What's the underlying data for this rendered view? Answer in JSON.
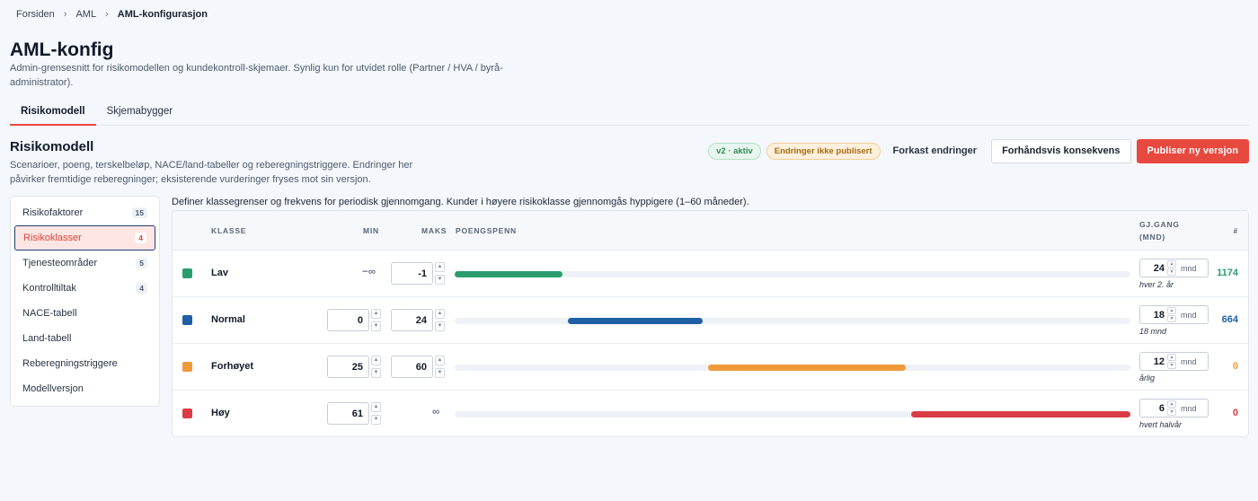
{
  "breadcrumb": {
    "home": "Forsiden",
    "section": "AML",
    "current": "AML-konfigurasjon",
    "separator": "›"
  },
  "page": {
    "title": "AML-konfig",
    "subtitle": "Admin-grensesnitt for risikomodellen og kundekontroll-skjemaer. Synlig kun for utvidet rolle (Partner / HVA / byrå-administrator)."
  },
  "tabs": [
    {
      "label": "Risikomodell"
    },
    {
      "label": "Skjemabygger"
    }
  ],
  "section": {
    "title": "Risikomodell",
    "description": "Scenarioer, poeng, terskelbeløp, NACE/land-tabeller og reberegningstriggere. Endringer her påvirker fremtidige reberegninger; eksisterende vurderinger fryses mot sin versjon."
  },
  "actions": {
    "version_badge": "v2 · aktiv",
    "unpublished_badge": "Endringer ikke publisert",
    "discard": "Forkast endringer",
    "preview": "Forhåndsvis konsekvens",
    "publish": "Publiser ny versjon"
  },
  "sidebar": {
    "items": [
      {
        "label": "Risikofaktorer",
        "count": "15"
      },
      {
        "label": "Risikoklasser",
        "count": "4"
      },
      {
        "label": "Tjenesteområder",
        "count": "5"
      },
      {
        "label": "Kontrolltiltak",
        "count": "4"
      },
      {
        "label": "NACE-tabell"
      },
      {
        "label": "Land-tabell"
      },
      {
        "label": "Reberegningstriggere"
      },
      {
        "label": "Modellversjon"
      }
    ]
  },
  "content": {
    "description": "Definer klassegrenser og frekvens for periodisk gjennomgang. Kunder i høyere risikoklasse gjennomgås hyppigere (1–60 måneder).",
    "headers": {
      "klasse": "KLASSE",
      "min": "MIN",
      "maks": "MAKS",
      "poengspenn": "POENGSPENN",
      "gjgang_1": "GJ.GANG",
      "gjgang_2": "(MND)",
      "count": "#"
    },
    "unit": "mnd",
    "rows": [
      {
        "name": "Lav",
        "color": "#2a9d6f",
        "min": "−∞",
        "max": "-1",
        "freq": "24",
        "freq_note": "hver 2. år",
        "count": "1174",
        "count_color": "#2a9d6f",
        "span_start": 0,
        "span_end": 0.16
      },
      {
        "name": "Normal",
        "color": "#1f5fa6",
        "min": "0",
        "max": "24",
        "freq": "18",
        "freq_note": "18 mnd",
        "count": "664",
        "count_color": "#1f5fa6",
        "span_start": 0.167,
        "span_end": 0.367
      },
      {
        "name": "Forhøyet",
        "color": "#ee9a3a",
        "min": "25",
        "max": "60",
        "freq": "12",
        "freq_note": "årlig",
        "count": "0",
        "count_color": "#ee9a3a",
        "span_start": 0.375,
        "span_end": 0.667
      },
      {
        "name": "Høy",
        "color": "#d93c45",
        "min": "61",
        "max": "∞",
        "freq": "6",
        "freq_note": "hvert halvår",
        "count": "0",
        "count_color": "#d93c45",
        "span_start": 0.675,
        "span_end": 1.0
      }
    ]
  }
}
